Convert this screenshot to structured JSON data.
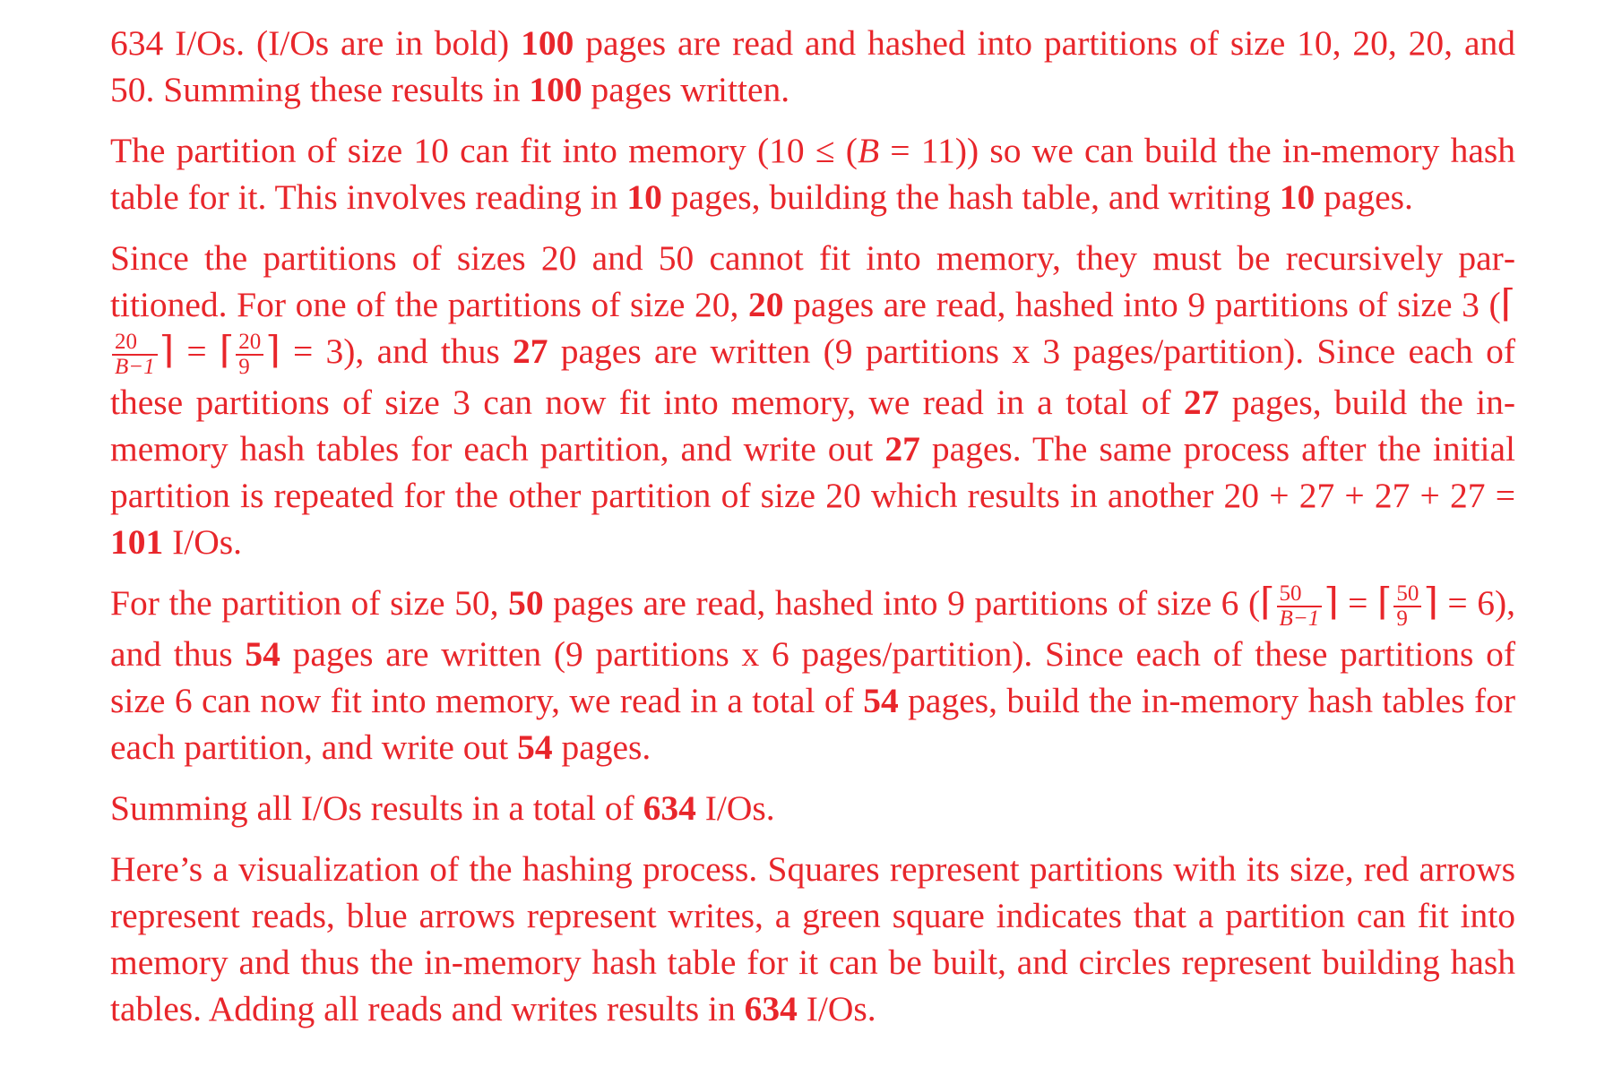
{
  "doc": {
    "p1": {
      "a": "634 I/Os. (I/Os are in bold) ",
      "b1": "100",
      "c": " pages are read and hashed into partitions of size 10, 20, 20, and 50. Summing these results in ",
      "b2": "100",
      "d": " pages written."
    },
    "p2": {
      "a": "The partition of size 10 can fit into memory (10 ≤ (",
      "var": "B",
      "eq": " = 11)) so we can build the in-memory hash table for it. This involves reading in ",
      "b1": "10",
      "c": " pages, building the hash table, and writing ",
      "b2": "10",
      "d": " pages."
    },
    "p3": {
      "a": "Since the partitions of sizes 20 and 50 cannot fit into memory, they must be recursively par­titioned. For one of the partitions of size 20, ",
      "b1": "20",
      "c": " pages are read, hashed into 9 partitions of size 3 (",
      "f1_num": "20",
      "f1_den": "B−1",
      "mid": " = ",
      "f2_num": "20",
      "f2_den": "9",
      "res": " = 3), and thus ",
      "b2": "27",
      "d": " pages are written (9 partitions x 3 pages/partition). Since each of these partitions of size 3 can now fit into memory, we read in a total of ",
      "b3": "27",
      "e": " pages, build the in-memory hash tables for each partition, and write out ",
      "b4": "27",
      "f": " pages. The same process after the initial partition is repeated for the other partition of size 20 which results in another 20 + 27 + 27 + 27 = ",
      "b5": "101",
      "g": " I/Os."
    },
    "p4": {
      "a": "For the partition of size 50, ",
      "b1": "50",
      "c": " pages are read, hashed into 9 partitions of size 6 (",
      "f1_num": "50",
      "f1_den": "B−1",
      "mid": " = ",
      "f2_num": "50",
      "f2_den": "9",
      "res": " = 6), and thus ",
      "b2": "54",
      "d": " pages are written (9 partitions x 6 pages/partition). Since each of these partitions of size 6 can now fit into memory, we read in a total of ",
      "b3": "54",
      "e": " pages, build the in-memory hash tables for each partition, and write out ",
      "b4": "54",
      "f": " pages."
    },
    "p5": {
      "a": "Summing all I/Os results in a total of ",
      "b1": "634",
      "c": " I/Os."
    },
    "p6": {
      "a": "Here’s a visualization of the hashing process. Squares represent partitions with its size, red arrows represent reads, blue arrows represent writes, a green square indicates that a partition can fit into memory and thus the in-memory hash table for it can be built, and circles represent building hash tables. Adding all reads and writes results in ",
      "b1": "634",
      "c": " I/Os."
    },
    "symbols": {
      "lceil": "⌈",
      "rceil": "⌉"
    }
  },
  "colors": {
    "text": "#e8262b",
    "background": "#ffffff"
  }
}
